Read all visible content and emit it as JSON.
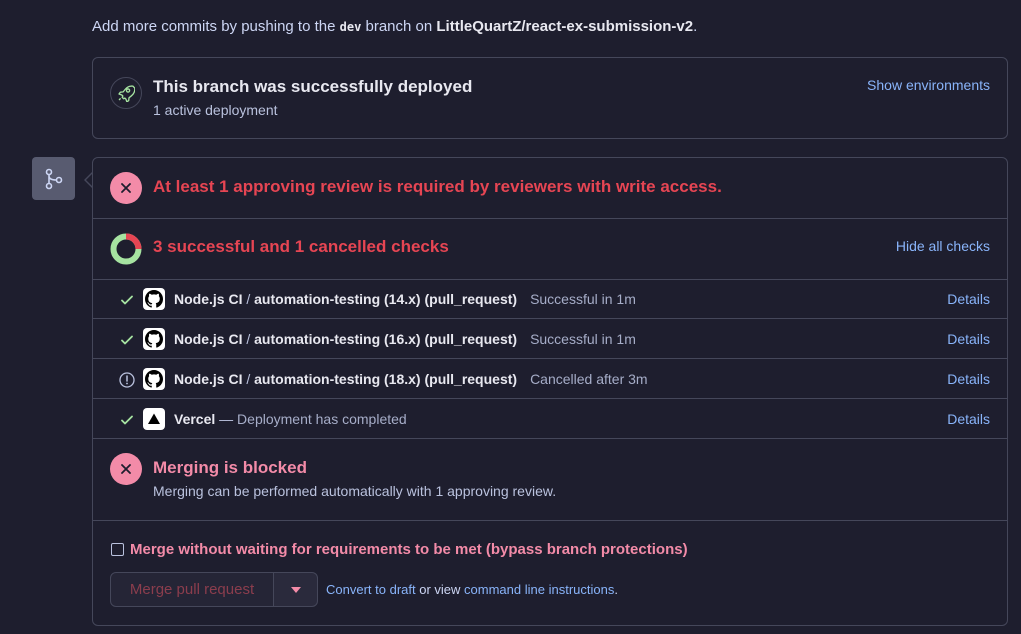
{
  "top": {
    "prefix": "Add more commits by pushing to the",
    "branch": "dev",
    "middle": "branch on",
    "repo": "LittleQuartZ/react-ex-submission-v2",
    "suffix": "."
  },
  "deployment": {
    "title": "This branch was successfully deployed",
    "subtitle": "1 active deployment",
    "link": "Show environments"
  },
  "review": {
    "title": "At least 1 approving review is required by reviewers with write access."
  },
  "checks": {
    "title": "3 successful and 1 cancelled checks",
    "link": "Hide all checks",
    "items": [
      {
        "name": "Node.js CI",
        "sep": " / ",
        "job": "automation-testing (14.x) (pull_request)",
        "desc": "Successful in 1m",
        "status": "success",
        "app": "github-icon",
        "details": "Details"
      },
      {
        "name": "Node.js CI",
        "sep": " / ",
        "job": "automation-testing (16.x) (pull_request)",
        "desc": "Successful in 1m",
        "status": "success",
        "app": "github-icon",
        "details": "Details"
      },
      {
        "name": "Node.js CI",
        "sep": " / ",
        "job": "automation-testing (18.x) (pull_request)",
        "desc": "Cancelled after 3m",
        "status": "cancelled",
        "app": "github-icon",
        "details": "Details"
      },
      {
        "name": "Vercel",
        "sep": " — ",
        "job": "",
        "desc": "Deployment has completed",
        "status": "success",
        "app": "vercel-icon",
        "details": "Details"
      }
    ]
  },
  "merge_block": {
    "title": "Merging is blocked",
    "subtitle": "Merging can be performed automatically with 1 approving review."
  },
  "bypass": {
    "label": "Merge without waiting for requirements to be met (bypass branch protections)",
    "checked": false
  },
  "actions": {
    "merge_button": "Merge pull request",
    "convert_link": "Convert to draft",
    "or_view": "or view",
    "cli_link": "command line instructions",
    "end": "."
  },
  "colors": {
    "background": "#1e1e2e",
    "error": "#f38ba8",
    "success": "#a6e3a1",
    "link": "#89b4fa"
  }
}
